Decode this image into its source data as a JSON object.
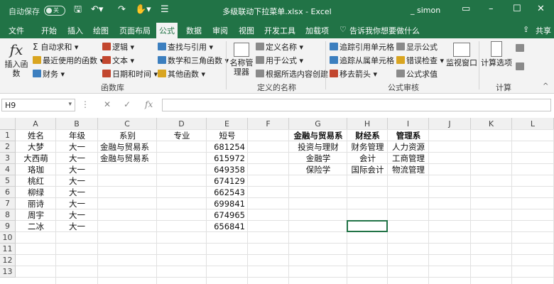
{
  "titlebar": {
    "autosave_label": "自动保存",
    "autosave_state": "关",
    "filename": "多级联动下拉菜单.xlsx - Excel",
    "user": "_ simon"
  },
  "tabs": [
    "文件",
    "开始",
    "插入",
    "绘图",
    "页面布局",
    "公式",
    "数据",
    "审阅",
    "视图",
    "开发工具",
    "加载项"
  ],
  "tell_me": "告诉我你想要做什么",
  "share": "共享",
  "ribbon": {
    "insert_function": "插入函数",
    "library": [
      "自动求和",
      "最近使用的函数",
      "财务",
      "逻辑",
      "文本",
      "日期和时间",
      "查找与引用",
      "数学和三角函数",
      "其他函数"
    ],
    "library_label": "函数库",
    "name_manager": "名称管理器",
    "names": [
      "定义名称",
      "用于公式",
      "根据所选内容创建"
    ],
    "names_label": "定义的名称",
    "audit": [
      "追踪引用单元格",
      "追踪从属单元格",
      "移去箭头",
      "显示公式",
      "错误检查",
      "公式求值"
    ],
    "watch_window": "监视窗口",
    "audit_label": "公式审核",
    "calc_options": "计算选项",
    "calc_label": "计算"
  },
  "formula_bar": {
    "name_box": "H9",
    "formula": ""
  },
  "columns": [
    "A",
    "B",
    "C",
    "D",
    "E",
    "F",
    "G",
    "H",
    "I",
    "J",
    "K",
    "L"
  ],
  "rows": [
    "1",
    "2",
    "3",
    "4",
    "5",
    "6",
    "7",
    "8",
    "9",
    "10",
    "11",
    "12",
    "13"
  ],
  "sheet": {
    "headers": [
      "姓名",
      "年级",
      "系别",
      "专业",
      "短号"
    ],
    "data": [
      [
        "大梦",
        "大一",
        "金融与贸易系",
        "",
        "681254"
      ],
      [
        "大西萌",
        "大一",
        "金融与贸易系",
        "",
        "615972"
      ],
      [
        "珞珈",
        "大一",
        "",
        "",
        "649358"
      ],
      [
        "桃红",
        "大一",
        "",
        "",
        "674129"
      ],
      [
        "柳绿",
        "大一",
        "",
        "",
        "662543"
      ],
      [
        "丽诗",
        "大一",
        "",
        "",
        "699841"
      ],
      [
        "周宇",
        "大一",
        "",
        "",
        "674965"
      ],
      [
        "二冰",
        "大一",
        "",
        "",
        "656841"
      ]
    ],
    "dept_headers": [
      "金融与贸易系",
      "财经系",
      "管理系"
    ],
    "dept_rows": [
      [
        "投资与理财",
        "财务管理",
        "人力资源"
      ],
      [
        "金融学",
        "会计",
        "工商管理"
      ],
      [
        "保险学",
        "国际会计",
        "物流管理"
      ]
    ]
  },
  "colors": {
    "brand": "#217346",
    "ribbon_bg": "#f3f3f3"
  }
}
